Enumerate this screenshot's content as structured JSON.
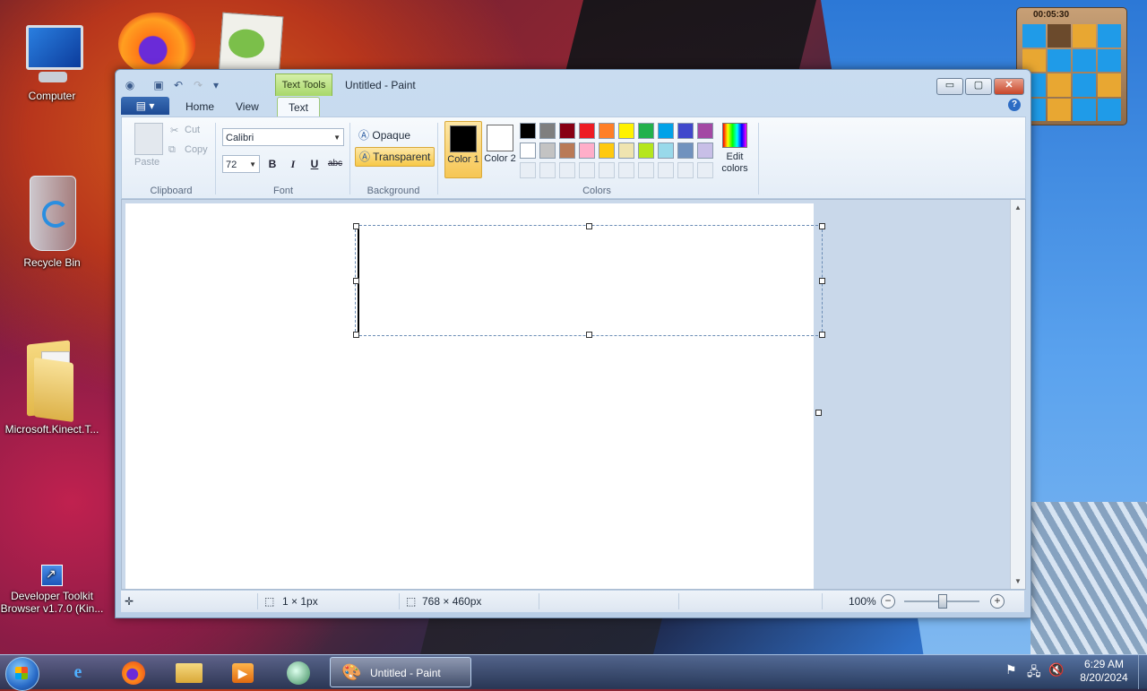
{
  "desktop": {
    "icons": [
      {
        "label": "Computer"
      },
      {
        "label": "Recycle Bin"
      },
      {
        "label": "Microsoft.Kinect.T..."
      },
      {
        "label": "Developer Toolkit Browser v1.7.0 (Kin..."
      }
    ]
  },
  "gadget": {
    "time": "00:05:30"
  },
  "window": {
    "title": "Untitled - Paint",
    "context_tab": "Text Tools",
    "controls": {
      "minimize": "▭",
      "maximize": "▢",
      "close": "✕"
    }
  },
  "tabs": {
    "file": "▤ ▾",
    "items": [
      "Home",
      "View",
      "Text"
    ],
    "active": "Text",
    "help": "?"
  },
  "ribbon": {
    "clipboard": {
      "paste": "Paste",
      "cut": "Cut",
      "copy": "Copy",
      "label": "Clipboard"
    },
    "font": {
      "family": "Calibri",
      "size": "72",
      "bold": "B",
      "italic": "I",
      "underline": "U",
      "strike": "abc",
      "label": "Font"
    },
    "background": {
      "opaque": "Opaque",
      "transparent": "Transparent",
      "selected": "Transparent",
      "label": "Background"
    },
    "colors": {
      "color1": {
        "label": "Color 1",
        "value": "#000000"
      },
      "color2": {
        "label": "Color 2",
        "value": "#ffffff"
      },
      "palette": [
        "#000000",
        "#7f7f7f",
        "#880015",
        "#ed1c24",
        "#ff7f27",
        "#fff200",
        "#22b14c",
        "#00a2e8",
        "#3f48cc",
        "#a349a4",
        "#ffffff",
        "#c3c3c3",
        "#b97a57",
        "#ffaec9",
        "#ffc90e",
        "#efe4b0",
        "#b5e61d",
        "#99d9ea",
        "#7092be",
        "#c8bfe7"
      ],
      "edit": "Edit colors",
      "label": "Colors"
    }
  },
  "statusbar": {
    "selection": "1 × 1px",
    "canvas_size": "768 × 460px",
    "zoom": "100%"
  },
  "taskbar": {
    "active_app": "Untitled - Paint",
    "clock_time": "6:29 AM",
    "clock_date": "8/20/2024"
  }
}
